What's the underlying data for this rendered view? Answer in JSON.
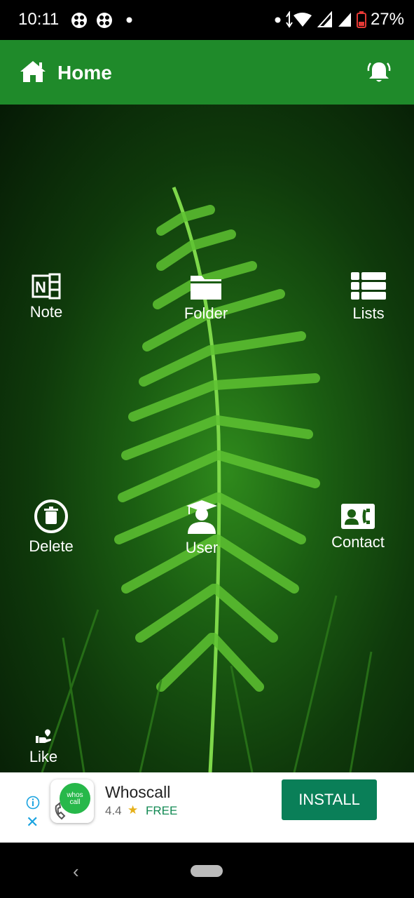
{
  "status_bar": {
    "time": "10:11",
    "battery": "27%"
  },
  "app_bar": {
    "title": "Home"
  },
  "tiles": {
    "note": "Note",
    "folder": "Folder",
    "lists": "Lists",
    "delete": "Delete",
    "user": "User",
    "contact": "Contact",
    "like": "Like"
  },
  "ad": {
    "app_name": "Whoscall",
    "rating": "4.4",
    "price": "FREE",
    "install_label": "INSTALL",
    "icon_text": "whos call"
  },
  "colors": {
    "app_bar": "#1f8a2a",
    "install": "#0a7f58",
    "price": "#138a54"
  }
}
